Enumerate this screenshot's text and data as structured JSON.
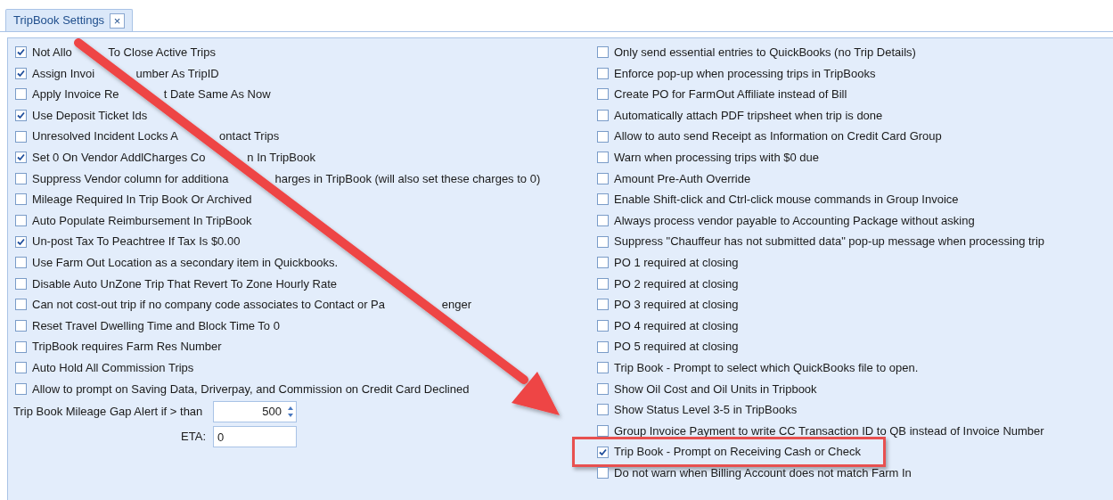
{
  "tab": {
    "label": "TripBook Settings",
    "close": "×"
  },
  "left_options": [
    {
      "parts": [
        "Not Allo",
        "To Close Active Trips"
      ],
      "checked": true
    },
    {
      "parts": [
        "Assign Invoi",
        "umber As TripID"
      ],
      "checked": true
    },
    {
      "parts": [
        "Apply Invoice Re",
        "t Date Same As Now"
      ],
      "checked": false
    },
    {
      "parts": [
        "Use Deposit Ticket Ids"
      ],
      "checked": true
    },
    {
      "parts": [
        "Unresolved Incident Locks A",
        "ontact Trips"
      ],
      "checked": false
    },
    {
      "parts": [
        "Set 0 On Vendor AddlCharges Co",
        "n In TripBook"
      ],
      "checked": true
    },
    {
      "parts": [
        "Suppress Vendor column for additiona",
        "harges in TripBook (will also set these charges to 0)"
      ],
      "checked": false
    },
    {
      "parts": [
        "Mileage Required In Trip Book Or Archived"
      ],
      "checked": false
    },
    {
      "parts": [
        "Auto Populate Reimbursement In TripBook"
      ],
      "checked": false
    },
    {
      "parts": [
        "Un-post Tax To Peachtree If Tax Is $0.00"
      ],
      "checked": true
    },
    {
      "parts": [
        "Use Farm Out Location as a secondary item in Quickbooks."
      ],
      "checked": false
    },
    {
      "parts": [
        "Disable Auto UnZone Trip That Revert To Zone Hourly Rate"
      ],
      "checked": false
    },
    {
      "parts": [
        "Can not cost-out trip if no company code associates to Contact or Pa",
        "enger"
      ],
      "checked": false
    },
    {
      "parts": [
        "Reset Travel Dwelling Time and Block Time To 0"
      ],
      "checked": false
    },
    {
      "parts": [
        "TripBook requires Farm Res Number"
      ],
      "checked": false
    },
    {
      "parts": [
        "Auto Hold All Commission Trips"
      ],
      "checked": false
    },
    {
      "parts": [
        "Allow to prompt on Saving Data, Driverpay, and Commission on Credit Card Declined"
      ],
      "checked": false
    }
  ],
  "mileage_gap": {
    "label": "Trip Book Mileage Gap Alert if > than",
    "value": "500"
  },
  "eta": {
    "label": "ETA:",
    "value": "0"
  },
  "right_options": [
    {
      "label": "Only send essential entries to QuickBooks (no Trip Details)",
      "checked": false,
      "highlighted": false
    },
    {
      "label": "Enforce pop-up when processing trips in TripBooks",
      "checked": false,
      "highlighted": false
    },
    {
      "label": "Create PO for FarmOut Affiliate instead of Bill",
      "checked": false,
      "highlighted": false
    },
    {
      "label": "Automatically attach PDF tripsheet when trip is done",
      "checked": false,
      "highlighted": false
    },
    {
      "label": "Allow to auto send Receipt as Information on Credit Card Group",
      "checked": false,
      "highlighted": false
    },
    {
      "label": "Warn when processing trips with $0 due",
      "checked": false,
      "highlighted": false
    },
    {
      "label": "Amount Pre-Auth Override",
      "checked": false,
      "highlighted": false
    },
    {
      "label": "Enable Shift-click and Ctrl-click mouse commands in Group Invoice",
      "checked": false,
      "highlighted": false
    },
    {
      "label": "Always process vendor payable to Accounting Package without asking",
      "checked": false,
      "highlighted": false
    },
    {
      "label": "Suppress \"Chauffeur has not submitted data\" pop-up message when processing trip",
      "checked": false,
      "highlighted": false
    },
    {
      "label": "PO 1 required at closing",
      "checked": false,
      "highlighted": false
    },
    {
      "label": "PO 2 required at closing",
      "checked": false,
      "highlighted": false
    },
    {
      "label": "PO 3 required at closing",
      "checked": false,
      "highlighted": false
    },
    {
      "label": "PO 4 required at closing",
      "checked": false,
      "highlighted": false
    },
    {
      "label": "PO 5 required at closing",
      "checked": false,
      "highlighted": false
    },
    {
      "label": "Trip Book - Prompt to select which QuickBooks file to open.",
      "checked": false,
      "highlighted": false
    },
    {
      "label": "Show Oil Cost and Oil Units in Tripbook",
      "checked": false,
      "highlighted": false
    },
    {
      "label": "Show Status Level 3-5 in TripBooks",
      "checked": false,
      "highlighted": false
    },
    {
      "label": "Group Invoice Payment to write CC Transaction ID to QB instead of Invoice Number",
      "checked": false,
      "highlighted": false
    },
    {
      "label": "Trip Book - Prompt on Receiving Cash or Check",
      "checked": true,
      "highlighted": true
    },
    {
      "label": "Do not warn when Billing Account does not match Farm In",
      "checked": false,
      "highlighted": false
    }
  ]
}
